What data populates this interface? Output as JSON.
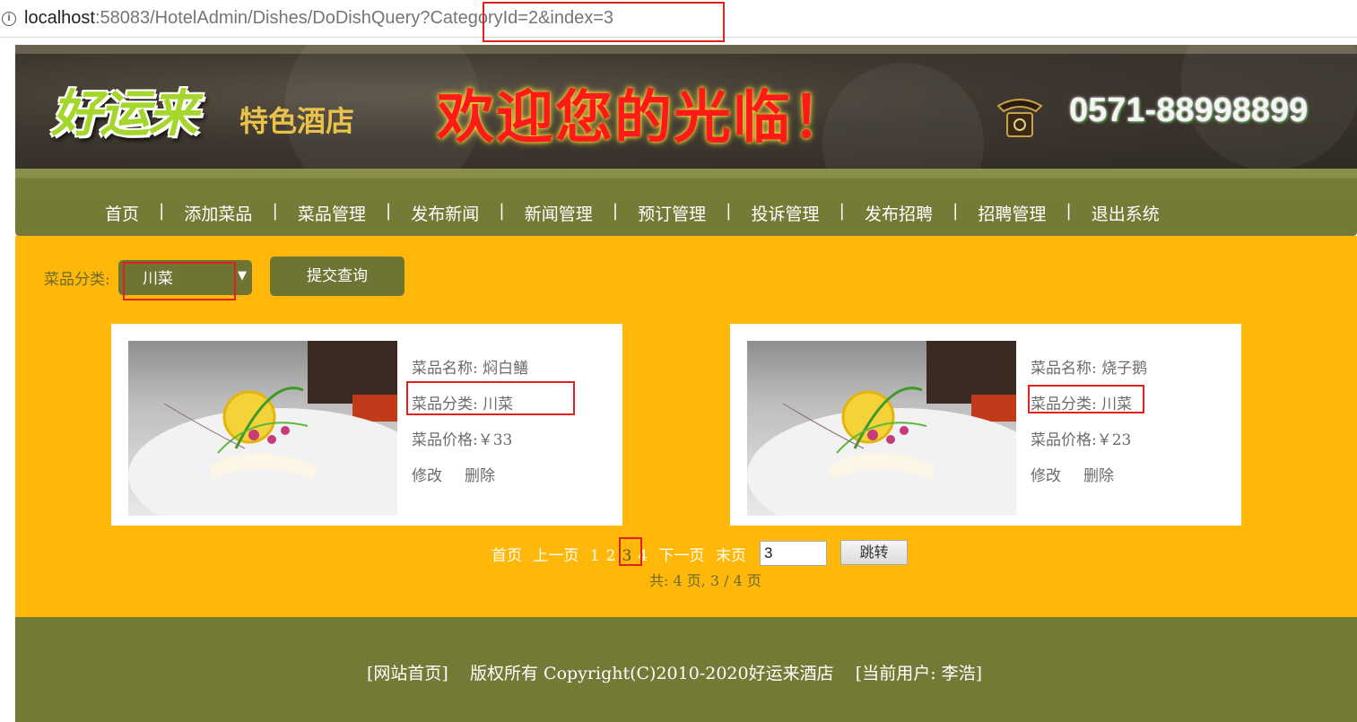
{
  "address_bar": {
    "host": "localhost",
    "rest": ":58083/HotelAdmin/Dishes/DoDishQuery?",
    "query": "CategoryId=2&index=3"
  },
  "banner": {
    "logo": "好运来",
    "logo_sub": "特色酒店",
    "welcome": "欢迎您的光临！",
    "phone": "0571-88998899"
  },
  "nav": {
    "items": [
      "首页",
      "添加菜品",
      "菜品管理",
      "发布新闻",
      "新闻管理",
      "预订管理",
      "投诉管理",
      "发布招聘",
      "招聘管理",
      "退出系统"
    ],
    "separator": "|"
  },
  "filter": {
    "label": "菜品分类:",
    "selected": "川菜",
    "submit_label": "提交查询"
  },
  "dishes": [
    {
      "name_label": "菜品名称:",
      "name": "焖白鳝",
      "category_label": "菜品分类:",
      "category": "川菜",
      "price_label": "菜品价格:",
      "price": "￥33",
      "edit": "修改",
      "delete": "删除"
    },
    {
      "name_label": "菜品名称:",
      "name": "烧子鹅",
      "category_label": "菜品分类:",
      "category": "川菜",
      "price_label": "菜品价格:",
      "price": "￥23",
      "edit": "修改",
      "delete": "删除"
    }
  ],
  "pager": {
    "first": "首页",
    "prev": "上一页",
    "pages": [
      "1",
      "2",
      "3",
      "4"
    ],
    "current": "3",
    "next": "下一页",
    "last": "末页",
    "jump_value": "3",
    "jump_label": "跳转",
    "summary": "共: 4 页, 3 / 4 页"
  },
  "footer": {
    "home_link": "[网站首页]",
    "copyright": "版权所有 Copyright(C)2010-2020好运来酒店",
    "current_user": "[当前用户: 李浩]"
  },
  "colors": {
    "main_bg": "#ffb70a",
    "nav_bg": "#737a36",
    "highlight": "#e32020"
  }
}
